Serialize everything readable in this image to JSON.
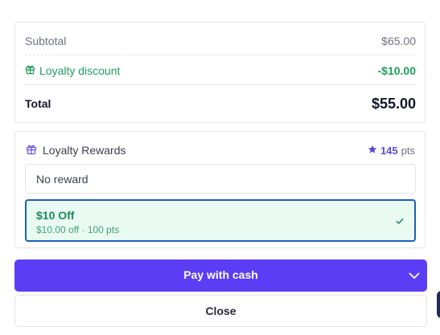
{
  "summary": {
    "subtotal_label": "Subtotal",
    "subtotal_value": "$65.00",
    "discount_label": "Loyalty discount",
    "discount_value": "-$10.00",
    "total_label": "Total",
    "total_value": "$55.00",
    "discount_color": "#1f9d5c"
  },
  "rewards": {
    "title": "Loyalty Rewards",
    "points_value": "145",
    "points_unit": "pts",
    "options": [
      {
        "label": "No reward",
        "selected": false
      },
      {
        "label": "$10 Off",
        "detail": "$10.00 off · 100 pts",
        "selected": true
      }
    ],
    "icons": {
      "gift": "gift-icon",
      "star": "star-icon",
      "check": "check-icon"
    }
  },
  "actions": {
    "pay_label": "Pay with cash",
    "close_label": "Close",
    "pay_color": "#5b3df5"
  }
}
